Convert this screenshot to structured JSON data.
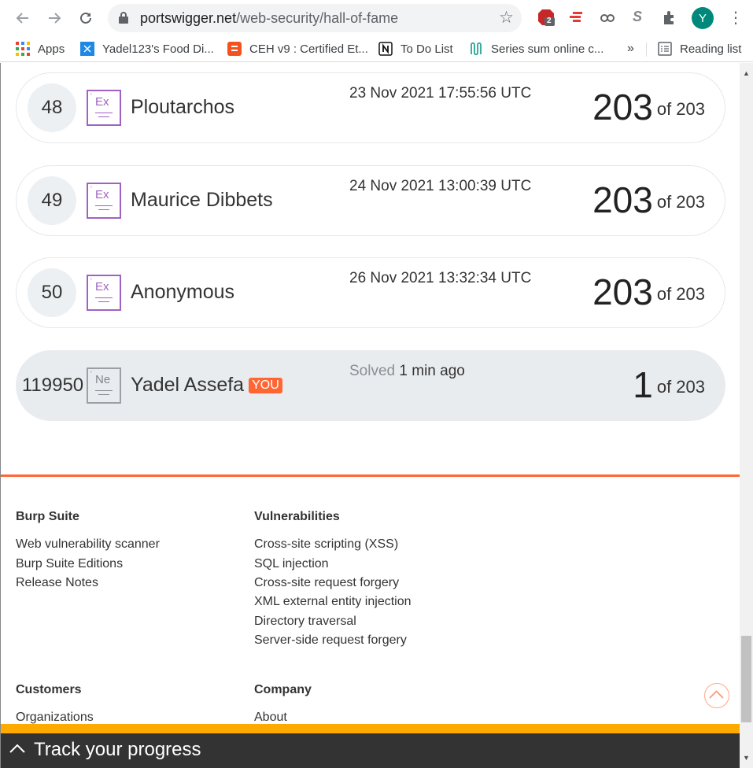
{
  "browser": {
    "url_host": "portswigger.net",
    "url_path": "/web-security/hall-of-fame",
    "avatar_letter": "Y",
    "ext_badge_count": "2",
    "ext_s_label": "S"
  },
  "bookmarks": [
    {
      "label": "Apps",
      "icon": "apps-grid-icon"
    },
    {
      "label": "Yadel123's Food Di...",
      "icon": "bookmark-x-icon"
    },
    {
      "label": "CEH v9 : Certified Et...",
      "icon": "blogger-icon"
    },
    {
      "label": "To Do List",
      "icon": "notion-icon"
    },
    {
      "label": "Series sum online c...",
      "icon": "series-icon"
    }
  ],
  "bookmarks_overflow": "»",
  "reading_list": "Reading list",
  "leaderboard": [
    {
      "rank": "48",
      "badge": "Ex",
      "name": "Ploutarchos",
      "date": "23 Nov 2021 17:55:56 UTC",
      "score": "203",
      "of": "of 203"
    },
    {
      "rank": "49",
      "badge": "Ex",
      "name": "Maurice Dibbets",
      "date": "24 Nov 2021 13:00:39 UTC",
      "score": "203",
      "of": "of 203"
    },
    {
      "rank": "50",
      "badge": "Ex",
      "name": "Anonymous",
      "date": "26 Nov 2021 13:32:34 UTC",
      "score": "203",
      "of": "of 203"
    }
  ],
  "me": {
    "rank": "119950",
    "badge": "Ne",
    "name": "Yadel Assefa",
    "you": "YOU",
    "solved_label": "Solved",
    "solved_time": "1 min ago",
    "score": "1",
    "of": "of 203"
  },
  "footer": {
    "burp": {
      "heading": "Burp Suite",
      "links": [
        "Web vulnerability scanner",
        "Burp Suite Editions",
        "Release Notes"
      ]
    },
    "vulns": {
      "heading": "Vulnerabilities",
      "links": [
        "Cross-site scripting (XSS)",
        "SQL injection",
        "Cross-site request forgery",
        "XML external entity injection",
        "Directory traversal",
        "Server-side request forgery"
      ]
    },
    "customers": {
      "heading": "Customers",
      "links": [
        "Organizations"
      ]
    },
    "company": {
      "heading": "Company",
      "links": [
        "About"
      ]
    }
  },
  "progress_bar": {
    "label": "Track your progress"
  },
  "colors": {
    "accent": "#ff6633",
    "badge_expert": "#9f62c2",
    "progress_bg": "#333333",
    "progress_top": "#ffaa00"
  }
}
